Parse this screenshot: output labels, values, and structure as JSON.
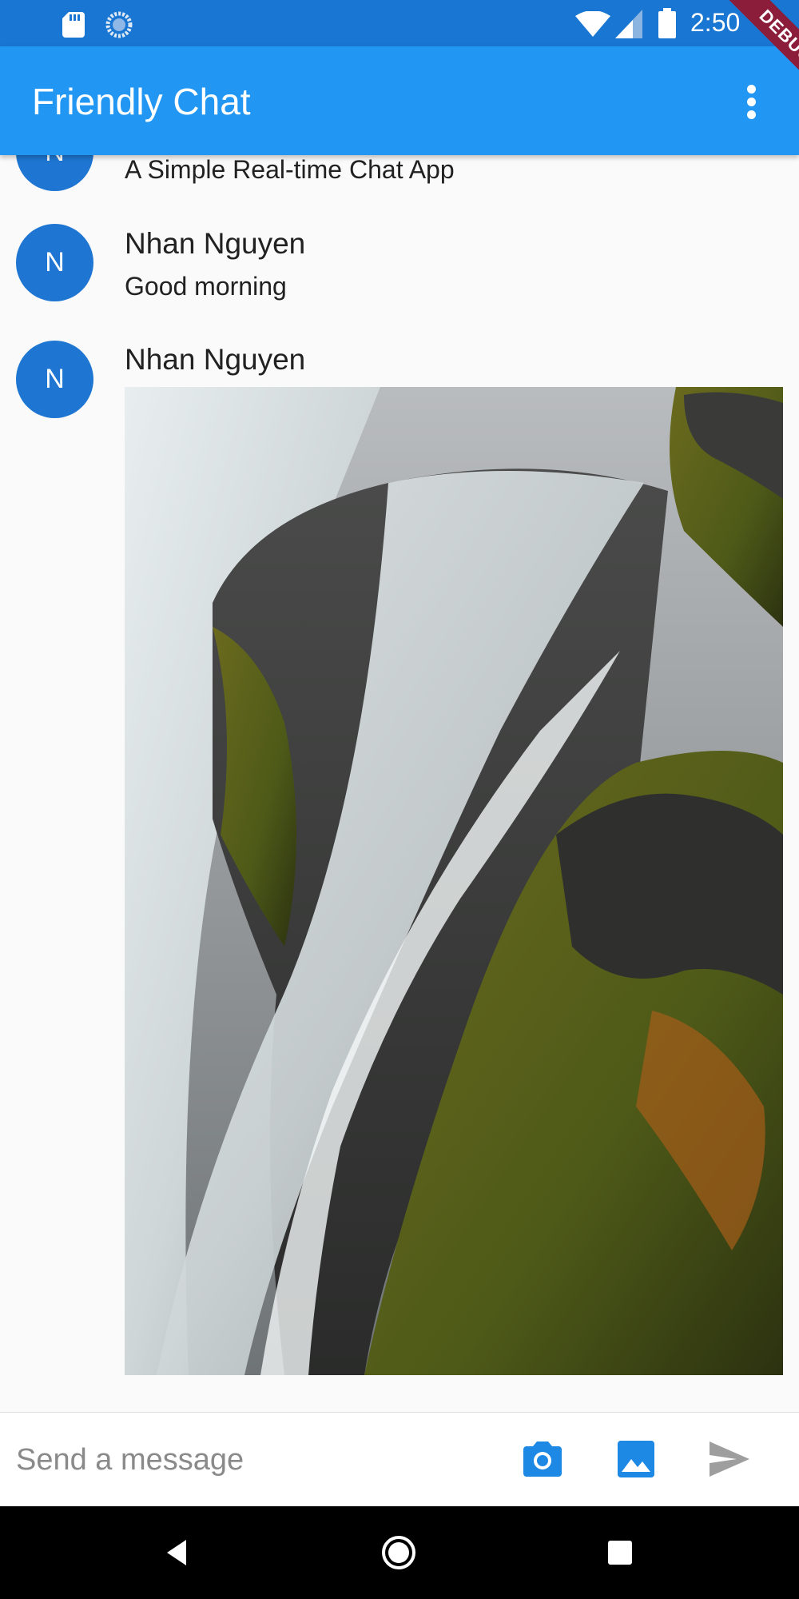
{
  "status_bar": {
    "time": "2:50",
    "debug_label": "DEBUG",
    "icons": [
      "sd-card-icon",
      "sync-icon",
      "wifi-icon",
      "signal-icon",
      "battery-icon"
    ]
  },
  "app_bar": {
    "title": "Friendly Chat",
    "menu_icon": "more-vert-icon"
  },
  "messages": [
    {
      "avatar_letter": "N",
      "sender": "",
      "text": "A Simple Real-time Chat App"
    },
    {
      "avatar_letter": "N",
      "sender": "Nhan Nguyen",
      "text": "Good morning"
    },
    {
      "avatar_letter": "N",
      "sender": "Nhan Nguyen",
      "image": "waterfall-photo"
    }
  ],
  "composer": {
    "placeholder": "Send a message",
    "value": "",
    "buttons": [
      "camera-icon",
      "image-icon",
      "send-icon"
    ]
  },
  "nav_bar": {
    "buttons": [
      "back-icon",
      "home-icon",
      "recents-icon"
    ]
  },
  "colors": {
    "status_bar": "#1976d2",
    "app_bar": "#2196f3",
    "avatar": "#1e76d2",
    "accent_icons": "#1e88e5",
    "send_icon_disabled": "#9e9e9e",
    "debug_banner": "#8b1d3a"
  }
}
